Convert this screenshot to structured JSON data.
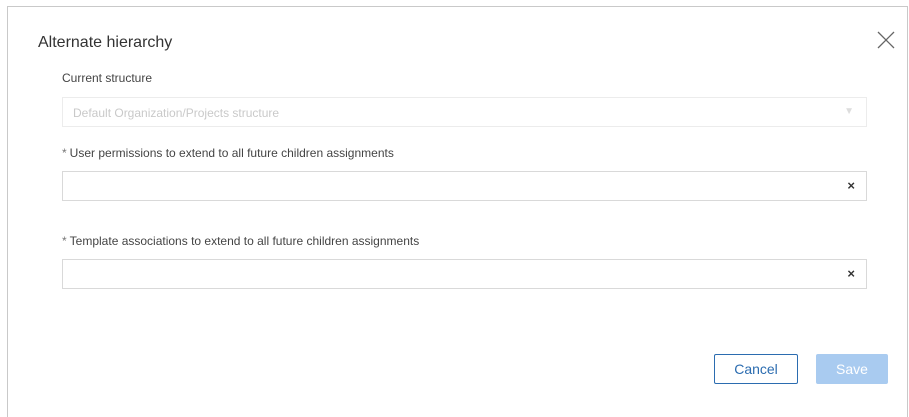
{
  "dialog": {
    "title": "Alternate hierarchy"
  },
  "current_structure": {
    "label": "Current structure",
    "value": "Default Organization/Projects structure",
    "caret": "▼"
  },
  "user_permissions": {
    "required_mark": "*",
    "label": "User permissions to extend to all future children assignments",
    "value": "",
    "clear": "×"
  },
  "template_associations": {
    "required_mark": "*",
    "label": "Template associations to extend to all future children assignments",
    "value": "",
    "clear": "×"
  },
  "buttons": {
    "cancel": "Cancel",
    "save": "Save"
  },
  "colors": {
    "accent": "#2b6cb0",
    "save_disabled": "#a9cbf0"
  },
  "icons": {
    "close": "close-icon",
    "dropdown": "chevron-down-icon",
    "clear": "clear-icon"
  }
}
